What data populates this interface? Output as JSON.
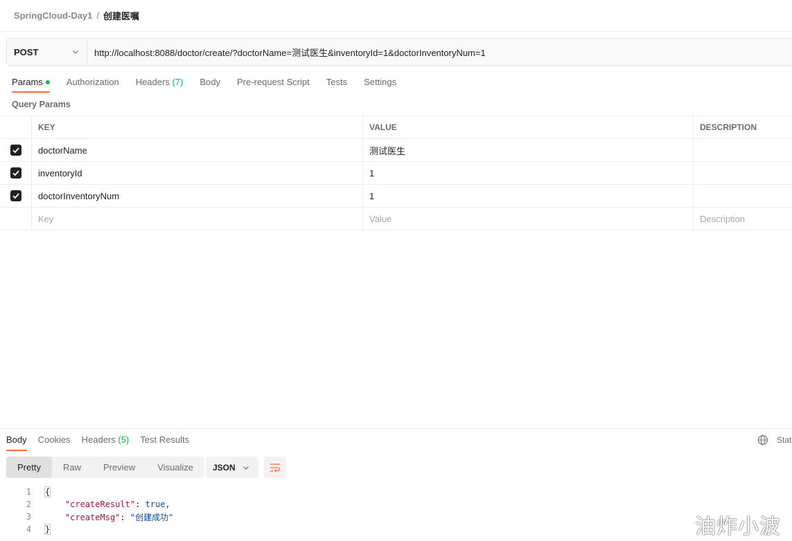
{
  "breadcrumb": {
    "collection": "SpringCloud-Day1",
    "separator": "/",
    "request": "创建医嘱"
  },
  "request": {
    "method": "POST",
    "url": "http://localhost:8088/doctor/create/?doctorName=测试医生&inventoryId=1&doctorInventoryNum=1"
  },
  "request_tabs": [
    {
      "label": "Params",
      "active": true,
      "indicator": "green-dot"
    },
    {
      "label": "Authorization"
    },
    {
      "label": "Headers",
      "count": "(7)"
    },
    {
      "label": "Body"
    },
    {
      "label": "Pre-request Script"
    },
    {
      "label": "Tests"
    },
    {
      "label": "Settings"
    }
  ],
  "params": {
    "section_title": "Query Params",
    "columns": {
      "key": "KEY",
      "value": "VALUE",
      "description": "DESCRIPTION"
    },
    "rows": [
      {
        "key": "doctorName",
        "value": "测试医生",
        "checked": true
      },
      {
        "key": "inventoryId",
        "value": "1",
        "checked": true
      },
      {
        "key": "doctorInventoryNum",
        "value": "1",
        "checked": true
      }
    ],
    "placeholder": {
      "key": "Key",
      "value": "Value",
      "description": "Description"
    }
  },
  "response_tabs": [
    {
      "label": "Body",
      "active": true
    },
    {
      "label": "Cookies"
    },
    {
      "label": "Headers",
      "count": "(5)"
    },
    {
      "label": "Test Results"
    }
  ],
  "status_label": "Statu",
  "view_modes": [
    "Pretty",
    "Raw",
    "Preview",
    "Visualize"
  ],
  "format": "JSON",
  "response_body": {
    "lines": [
      "1",
      "2",
      "3",
      "4"
    ],
    "open_brace": "{",
    "close_brace": "}",
    "field1_key": "\"createResult\"",
    "field1_value": "true",
    "field2_key": "\"createMsg\"",
    "field2_value": "\"创建成功\""
  },
  "watermark": "油炸小波",
  "colors": {
    "accent_tab": "#ff6c37",
    "success_green": "#0cbb52",
    "json_key": "#a3172e",
    "json_value": "#0a4ba3"
  }
}
